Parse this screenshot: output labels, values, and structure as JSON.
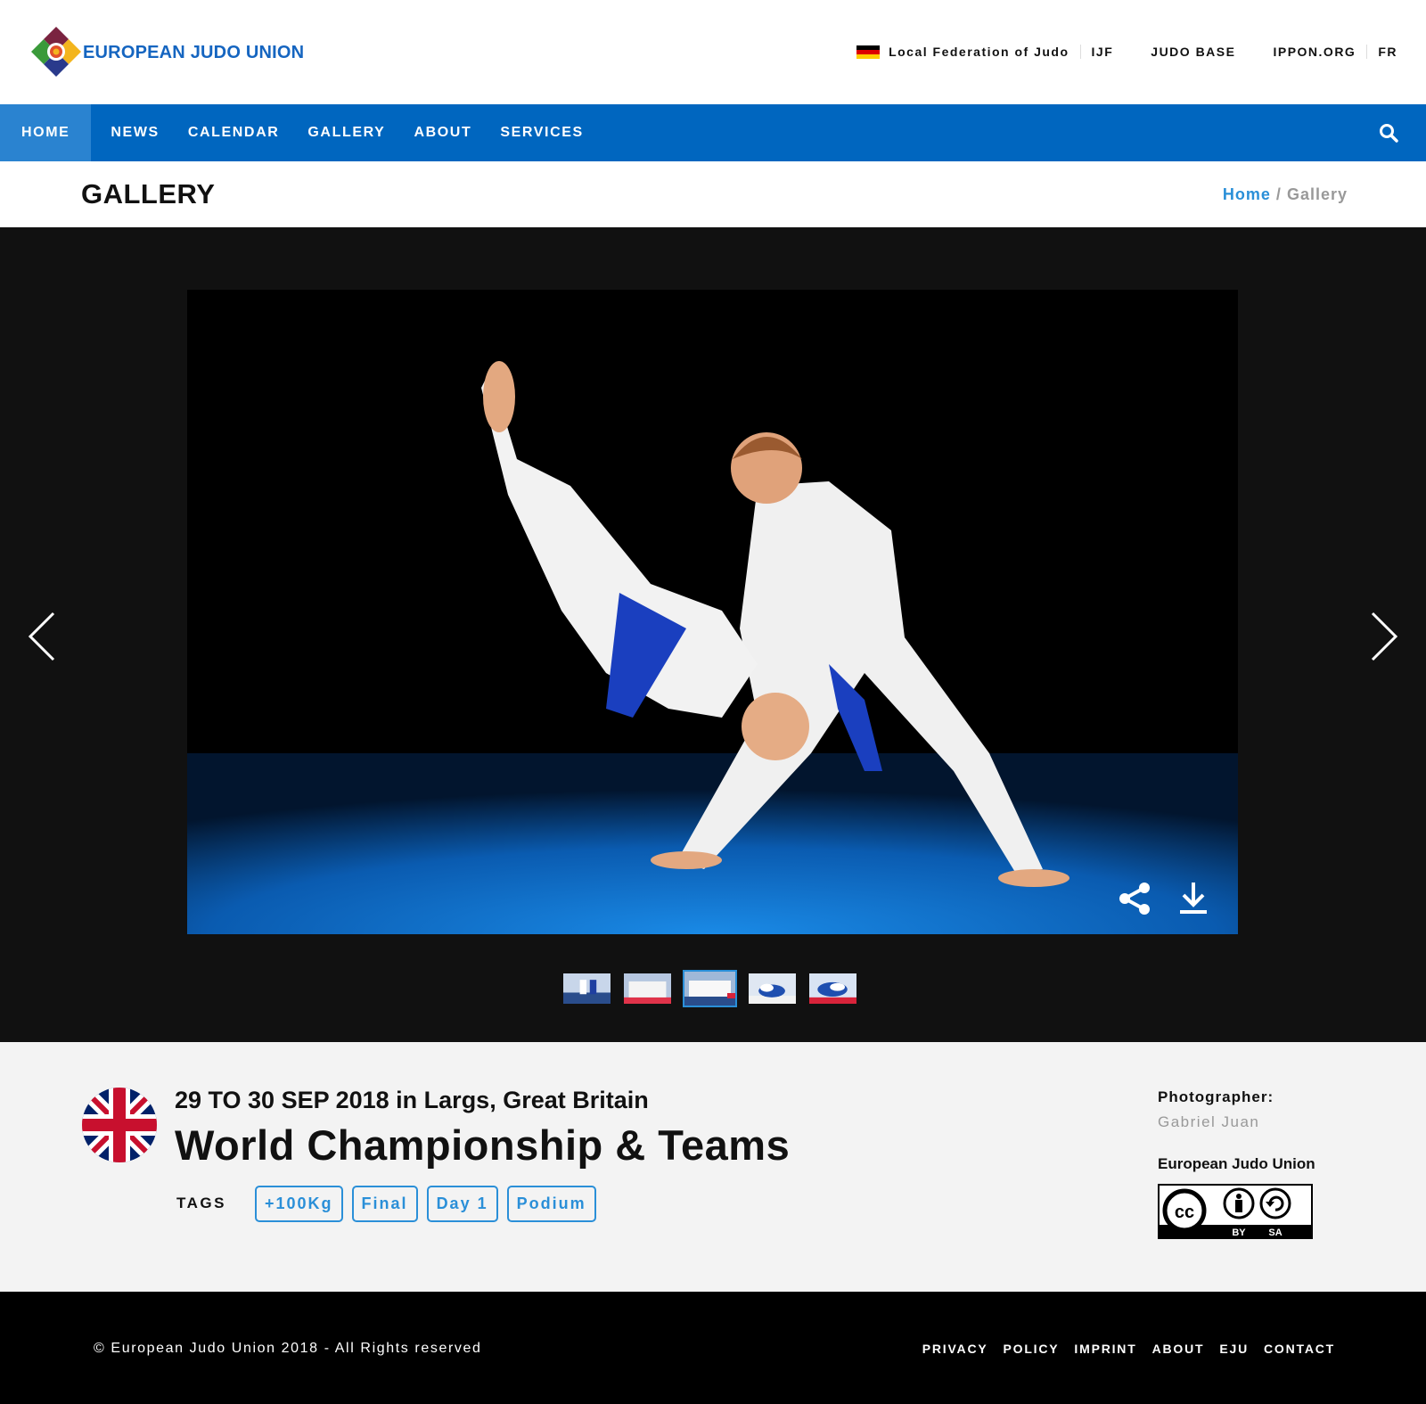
{
  "brand": {
    "name": "EUROPEAN JUDO UNION"
  },
  "toplinks": {
    "federation": "Local Federation of Judo",
    "ijf": "IJF",
    "judobase": "JUDO BASE",
    "ippon": "IPPON.ORG",
    "lang": "FR"
  },
  "nav": {
    "items": [
      {
        "label": "HOME",
        "active": true
      },
      {
        "label": "NEWS"
      },
      {
        "label": "CALENDAR"
      },
      {
        "label": "GALLERY"
      },
      {
        "label": "ABOUT"
      },
      {
        "label": "SERVICES"
      }
    ]
  },
  "page": {
    "title": "GALLERY",
    "breadcrumb": {
      "home": "Home",
      "separator": "/",
      "current": "Gallery"
    }
  },
  "gallery": {
    "icons": [
      "chevron-left-icon",
      "chevron-right-icon",
      "share-icon",
      "download-icon"
    ],
    "thumb_count": 5,
    "active_thumb": 3
  },
  "event": {
    "date": "29 TO 30 SEP 2018 in Largs, Great Britain",
    "title": "World Championship & Teams",
    "tags_label": "TAGS",
    "tags": [
      "+100Kg",
      "Final",
      "Day 1",
      "Podium"
    ],
    "photographer_label": "Photographer:",
    "photographer": "Gabriel Juan",
    "organization": "European Judo Union",
    "license": {
      "by": "BY",
      "sa": "SA"
    }
  },
  "footer": {
    "copyright": "© European Judo Union 2018 - All Rights reserved",
    "links": [
      "PRIVACY",
      "POLICY",
      "IMPRINT",
      "ABOUT",
      "EJU",
      "CONTACT"
    ]
  },
  "colors": {
    "brand_blue": "#0066bf",
    "accent": "#2a8fd8",
    "stage": "#111111",
    "footer": "#000000"
  }
}
